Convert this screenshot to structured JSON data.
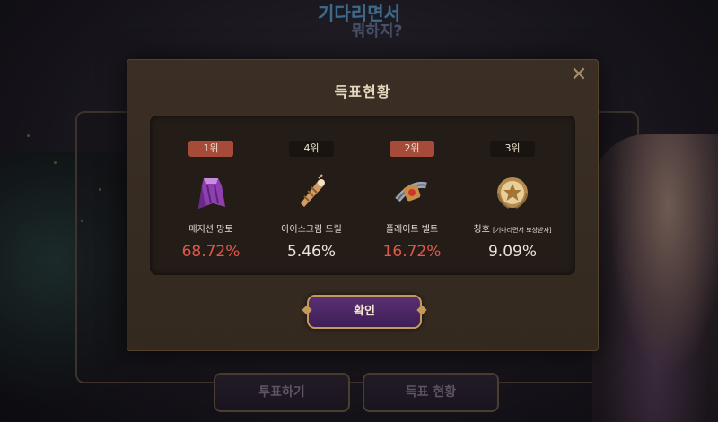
{
  "background": {
    "logo_line1": "기다리면서",
    "logo_line2": "뭐하지?",
    "vote_button_label": "투표하기",
    "status_button_label": "득표 현황"
  },
  "modal": {
    "title": "득표현황",
    "close_icon": "close-icon",
    "confirm_label": "확인",
    "items": [
      {
        "rank": "1위",
        "name": "매지션 망토",
        "name_extra": "",
        "percent": "68.72%",
        "value": 68.72,
        "icon": "cape-icon",
        "highlight": true
      },
      {
        "rank": "4위",
        "name": "아이스크림 드릴",
        "name_extra": "",
        "percent": "5.46%",
        "value": 5.46,
        "icon": "drill-icon",
        "highlight": false
      },
      {
        "rank": "2위",
        "name": "플레이트 벨트",
        "name_extra": "",
        "percent": "16.72%",
        "value": 16.72,
        "icon": "belt-icon",
        "highlight": true
      },
      {
        "rank": "3위",
        "name": "칭호",
        "name_extra": "[기다리면서 보상받자]",
        "percent": "9.09%",
        "value": 9.09,
        "icon": "medal-icon",
        "highlight": false
      }
    ]
  },
  "colors": {
    "accent_red": "#e0584a",
    "rank_top": "#a64a3a",
    "confirm_purple": "#5a2f74",
    "gold_border": "#c49a5c"
  }
}
